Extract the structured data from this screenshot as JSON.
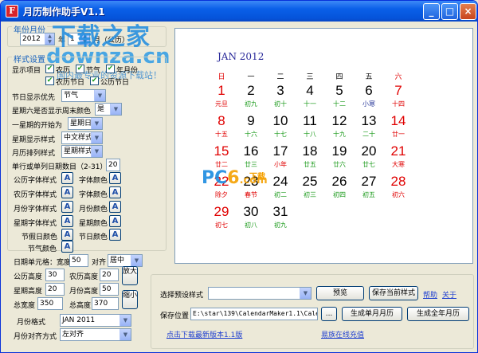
{
  "window": {
    "title": "月历制作助手V1.1",
    "icon_letter": "F",
    "min_label": "_",
    "max_label": "□",
    "close_label": "×"
  },
  "watermark": {
    "line1": "下载之家",
    "line2": "downza.cn",
    "line3": "国内最专业的资源下载站！",
    "pc6_pc": "PC",
    "pc6_six": "6",
    "pc6_com": ".com",
    "pc6_dl": "下载"
  },
  "year_month": {
    "group_label": "年份月份",
    "year_value": "2012",
    "year_unit": "年",
    "month_value": "1",
    "month_unit": "月（公历）"
  },
  "style": {
    "group_label": "样式设置",
    "display_items_label": "显示项目",
    "check_lunar": "农历",
    "check_solar_term": "节气",
    "check_year_month": "年月份",
    "check_lunar_festival": "农历节日",
    "check_gregorian_festival": "公历节日",
    "festival_priority_label": "节日显示优先",
    "festival_priority_value": "节气",
    "sat_weekend_color_label": "星期六是否显示周末颜色",
    "sat_weekend_color_value": "是",
    "week_start_label": "一星期的开始为",
    "week_start_value": "星期日",
    "week_display_label": "星期显示样式",
    "week_display_value": "中文样式",
    "month_arrange_label": "月历排列样式",
    "month_arrange_value": "星期样式",
    "cells_per_row_label": "单行或单列日期数目（2-31）",
    "cells_per_row_value": "20",
    "gregorian_font_label": "公历字体样式",
    "lunar_font_label": "农历字体样式",
    "month_font_label": "月份字体样式",
    "week_font_label": "星期字体样式",
    "holiday_color_label": "节假日颜色",
    "solar_term_color_label": "节气颜色",
    "font_color_label": "字体颜色",
    "month_color_label": "月份颜色",
    "week_color_label": "星期颜色",
    "festival_color_label": "节日颜色",
    "a_glyph": "A"
  },
  "layout_fields": {
    "date_cell_label": "日期单元格：宽度",
    "date_cell_width": "50",
    "align_label": "对齐",
    "align_value": "居中",
    "gregorian_height_label": "公历高度",
    "gregorian_height_value": "30",
    "lunar_height_label": "农历高度",
    "lunar_height_value": "20",
    "week_height_label": "星期高度",
    "week_height_value": "20",
    "month_height_label": "月份高度",
    "month_height_value": "50",
    "total_width_label": "总宽度",
    "total_width_value": "350",
    "total_height_label": "总高度",
    "total_height_value": "370",
    "zoom_in_label": "放大",
    "zoom_out_label": "缩小",
    "month_format_label": "月份格式",
    "month_format_value": "JAN 2011",
    "month_align_label": "月份对齐方式",
    "month_align_value": "左对齐"
  },
  "calendar": {
    "title": "JAN 2012",
    "weekdays": [
      "日",
      "一",
      "二",
      "三",
      "四",
      "五",
      "六"
    ],
    "weeks": [
      [
        {
          "d": "1",
          "l": "元旦",
          "dc": "c-red",
          "lc": "c-red"
        },
        {
          "d": "2",
          "l": "初九",
          "dc": "c-black",
          "lc": "c-green"
        },
        {
          "d": "3",
          "l": "初十",
          "dc": "c-black",
          "lc": "c-green"
        },
        {
          "d": "4",
          "l": "十一",
          "dc": "c-black",
          "lc": "c-green"
        },
        {
          "d": "5",
          "l": "十二",
          "dc": "c-black",
          "lc": "c-green"
        },
        {
          "d": "6",
          "l": "小寒",
          "dc": "c-black",
          "lc": "c-blue"
        },
        {
          "d": "7",
          "l": "十四",
          "dc": "c-red",
          "lc": "c-red"
        }
      ],
      [
        {
          "d": "8",
          "l": "十五",
          "dc": "c-red",
          "lc": "c-red"
        },
        {
          "d": "9",
          "l": "十六",
          "dc": "c-black",
          "lc": "c-green"
        },
        {
          "d": "10",
          "l": "十七",
          "dc": "c-black",
          "lc": "c-green"
        },
        {
          "d": "11",
          "l": "十八",
          "dc": "c-black",
          "lc": "c-green"
        },
        {
          "d": "12",
          "l": "十九",
          "dc": "c-black",
          "lc": "c-green"
        },
        {
          "d": "13",
          "l": "二十",
          "dc": "c-black",
          "lc": "c-green"
        },
        {
          "d": "14",
          "l": "廿一",
          "dc": "c-red",
          "lc": "c-red"
        }
      ],
      [
        {
          "d": "15",
          "l": "廿二",
          "dc": "c-red",
          "lc": "c-red"
        },
        {
          "d": "16",
          "l": "廿三",
          "dc": "c-black",
          "lc": "c-green"
        },
        {
          "d": "17",
          "l": "小年",
          "dc": "c-black",
          "lc": "c-red"
        },
        {
          "d": "18",
          "l": "廿五",
          "dc": "c-black",
          "lc": "c-green"
        },
        {
          "d": "19",
          "l": "廿六",
          "dc": "c-black",
          "lc": "c-green"
        },
        {
          "d": "20",
          "l": "廿七",
          "dc": "c-black",
          "lc": "c-green"
        },
        {
          "d": "21",
          "l": "大寒",
          "dc": "c-red",
          "lc": "c-red"
        }
      ],
      [
        {
          "d": "22",
          "l": "除夕",
          "dc": "c-red",
          "lc": "c-red"
        },
        {
          "d": "23",
          "l": "春节",
          "dc": "c-black",
          "lc": "c-red"
        },
        {
          "d": "24",
          "l": "初二",
          "dc": "c-black",
          "lc": "c-green"
        },
        {
          "d": "25",
          "l": "初三",
          "dc": "c-black",
          "lc": "c-green"
        },
        {
          "d": "26",
          "l": "初四",
          "dc": "c-black",
          "lc": "c-green"
        },
        {
          "d": "27",
          "l": "初五",
          "dc": "c-black",
          "lc": "c-green"
        },
        {
          "d": "28",
          "l": "初六",
          "dc": "c-red",
          "lc": "c-red"
        }
      ],
      [
        {
          "d": "29",
          "l": "初七",
          "dc": "c-red",
          "lc": "c-red"
        },
        {
          "d": "30",
          "l": "初八",
          "dc": "c-black",
          "lc": "c-green"
        },
        {
          "d": "31",
          "l": "初九",
          "dc": "c-black",
          "lc": "c-green"
        }
      ]
    ]
  },
  "bottom": {
    "preset_label": "选择预设样式",
    "preset_value": "",
    "preview_button": "预览",
    "save_style_button": "保存当前样式",
    "help_link": "帮助",
    "about_link": "关于",
    "save_path_label": "保存位置",
    "save_path_value": "E:\\star\\139\\CalendarMaker1.1\\Calen",
    "browse_button": "...",
    "gen_month_button": "生成单月月历",
    "gen_year_button": "生成全年月历",
    "download_link": "点击下载最新版本1.1版",
    "recharge_link": "易族在线充值"
  }
}
